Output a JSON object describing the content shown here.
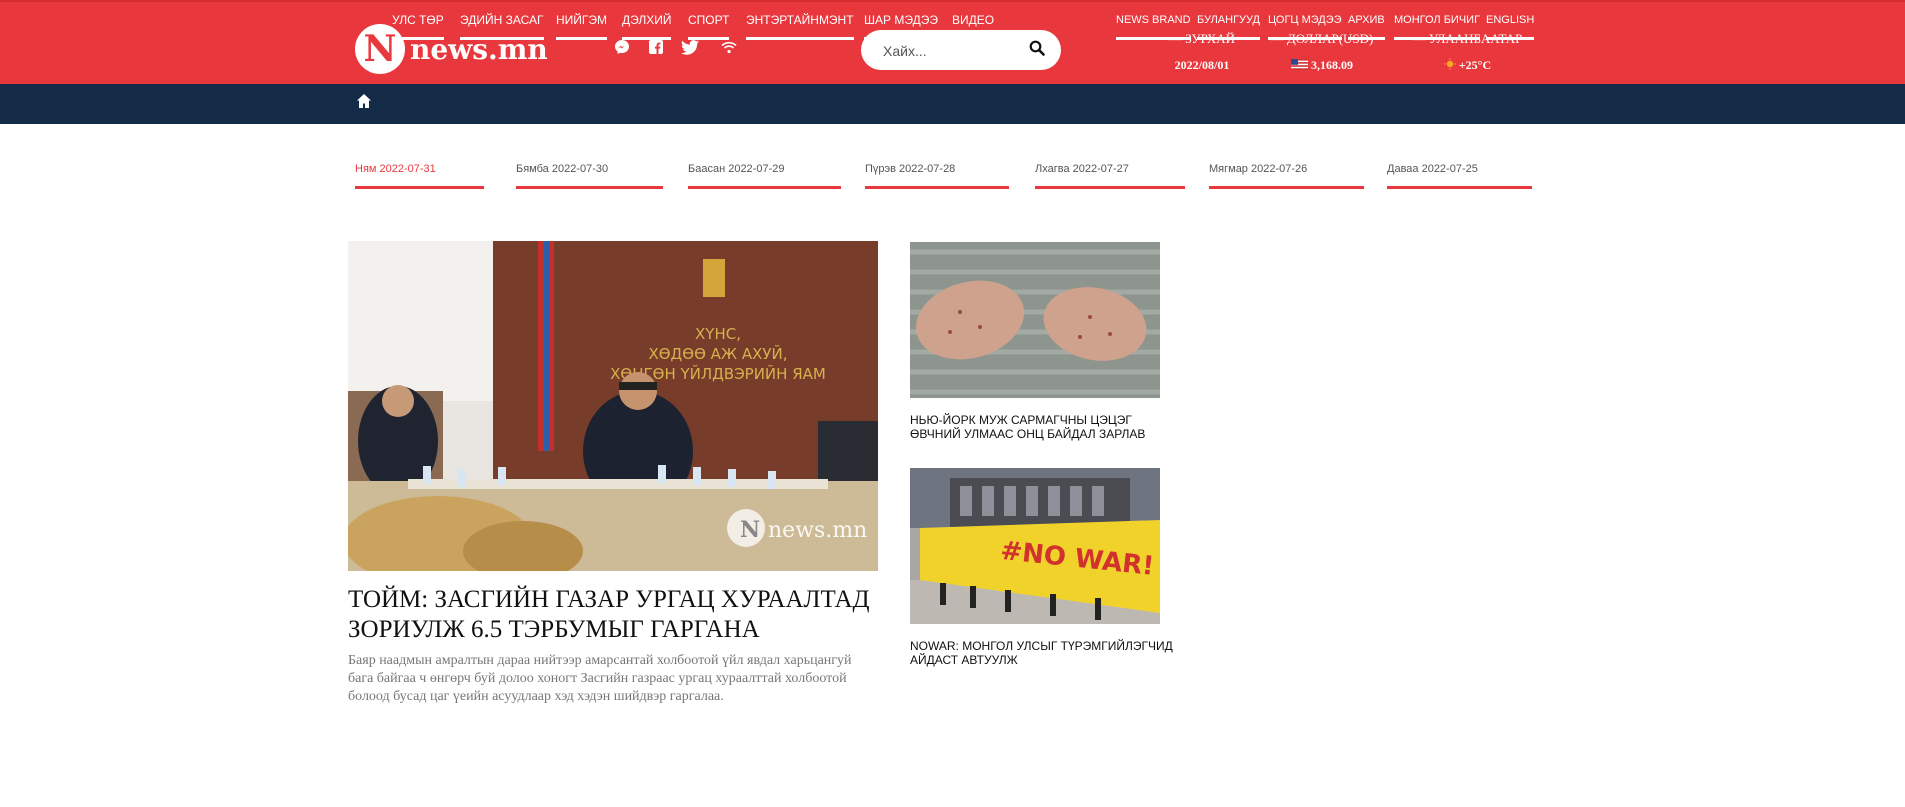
{
  "header": {
    "logo_letter": "N",
    "logo_text": "news.mn",
    "social_icons": [
      "messenger-icon",
      "facebook-icon",
      "twitter-icon",
      "rss-icon"
    ],
    "search_placeholder": "Хайх...",
    "info": [
      {
        "label": "— ЗУРХАЙ",
        "value": "2022/08/01"
      },
      {
        "label": "— ДОЛЛАР(USD)",
        "value": "3,168.09"
      },
      {
        "label": "— УЛААНБААТАР",
        "value": "+25°C"
      }
    ],
    "colors": {
      "brand_red": "#e8383d",
      "nav_navy": "#132b47"
    }
  },
  "nav": {
    "main": [
      "УЛС ТӨР",
      "ЭДИЙН ЗАСАГ",
      "НИЙГЭМ",
      "ДЭЛХИЙ",
      "СПОРТ",
      "ЭНТЭРТАЙНМЭНТ",
      "ШАР МЭДЭЭ",
      "ВИДЕО"
    ],
    "right": [
      "NEWS BRAND",
      "БУЛАНГУУД",
      "ЦОГЦ МЭДЭЭ",
      "АРХИВ",
      "МОНГОЛ БИЧИГ",
      "ENGLISH"
    ]
  },
  "dates": [
    "Ням 2022-07-31",
    "Бямба 2022-07-30",
    "Баасан 2022-07-29",
    "Пүрэв 2022-07-28",
    "Лхагва 2022-07-27",
    "Мягмар 2022-07-26",
    "Даваа 2022-07-25"
  ],
  "main_article": {
    "image_sign": [
      "ХҮНС,",
      "ХӨДӨӨ АЖ АХУЙ,",
      "ХӨНГӨН ҮЙЛДВЭРИЙН ЯАМ"
    ],
    "watermark": "news.mn",
    "title": "ТОЙМ: ЗАСГИЙН ГАЗАР УРГАЦ ХУРААЛТАД ЗОРИУЛЖ 6.5 ТЭРБУМЫГ ГАРГАНА",
    "desc": "Баяр наадмын амралтын дараа нийтээр амарсантай холбоотой үйл явдал харьцангуй бага байгаа ч өнгөрч буй долоо хоногт Засгийн газраас ургац хураалттай холбоотой болоод бусад цаг үеийн асуудлаар хэд хэдэн шийдвэр гаргалаа."
  },
  "side_articles": [
    {
      "title": "НЬЮ-ЙОРК МУЖ САРМАГЧНЫ ЦЭЦЭГ ӨВЧНИЙ УЛМААС ОНЦ БАЙДАЛ ЗАРЛАВ",
      "image": "hands-photo"
    },
    {
      "title": "NOWAR: МОНГОЛ УЛСЫГ ТҮРЭМГИЙЛЭГЧИД АЙДАСТ АВТУУЛЖ",
      "image": "protest-photo",
      "banner_text": "#NO WAR!"
    }
  ]
}
